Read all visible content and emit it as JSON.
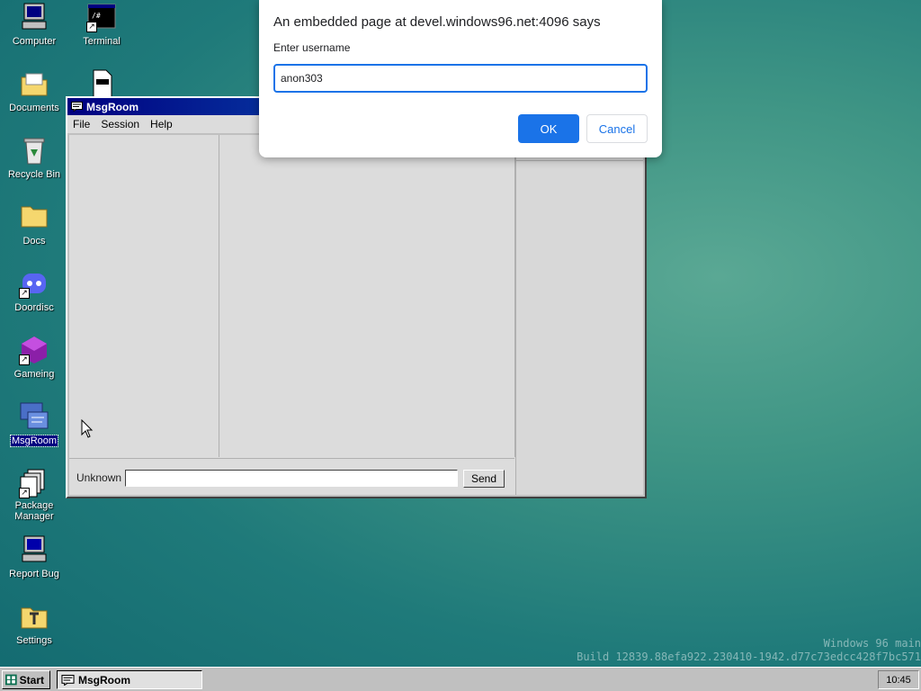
{
  "desktop": {
    "icons": [
      {
        "label": "Computer",
        "icon": "computer-icon"
      },
      {
        "label": "Terminal",
        "icon": "terminal-icon"
      },
      {
        "label": "Documents",
        "icon": "documents-icon"
      },
      {
        "label": "Recycle Bin",
        "icon": "recycle-bin-icon"
      },
      {
        "label": "Docs",
        "icon": "folder-icon"
      },
      {
        "label": "Doordisc",
        "icon": "doordisc-icon"
      },
      {
        "label": "Gameing",
        "icon": "gameing-icon"
      },
      {
        "label": "MsgRoom",
        "icon": "msgroom-icon"
      },
      {
        "label": "Package Manager",
        "icon": "package-manager-icon"
      },
      {
        "label": "Report Bug",
        "icon": "report-bug-icon"
      },
      {
        "label": "Settings",
        "icon": "settings-icon"
      }
    ],
    "watermark_line1": "Windows 96 main",
    "watermark_line2": "Build 12839.88efa922.230410-1942.d77c73edcc428f7bc571"
  },
  "window": {
    "title": "MsgRoom",
    "menu": [
      "File",
      "Session",
      "Help"
    ],
    "username_label": "Unknown",
    "message_value": "",
    "send_label": "Send"
  },
  "dialog": {
    "title": "An embedded page at devel.windows96.net:4096 says",
    "label": "Enter username",
    "value": "anon303",
    "ok_label": "OK",
    "cancel_label": "Cancel"
  },
  "taskbar": {
    "start_label": "Start",
    "task_label": "MsgRoom",
    "clock": "10:45"
  }
}
